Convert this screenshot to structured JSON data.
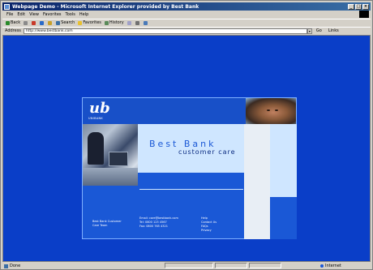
{
  "window": {
    "title": "Webpage Demo - Microsoft Internet Explorer provided by Best Bank",
    "minimize": "_",
    "maximize": "□",
    "close": "×"
  },
  "menu": {
    "items": [
      "File",
      "Edit",
      "View",
      "Favorites",
      "Tools",
      "Help"
    ]
  },
  "toolbar": {
    "back": "Back",
    "search": "Search",
    "favorites": "Favorites",
    "history": "History"
  },
  "address": {
    "label": "Address",
    "value": "http://www.bestbank.com",
    "go": "Go",
    "links": "Links"
  },
  "page": {
    "logo": "ub",
    "logo_sub": "UNIBANK",
    "headline": "Best Bank",
    "subline": "customer care",
    "footer": {
      "col1": [
        "Best Bank Customer",
        "Care Team"
      ],
      "col2": [
        "Email: care@bestbank.com",
        "Tel: 0800 123 4567",
        "Fax: 0800 765 4321"
      ],
      "col3": [
        "Help",
        "Contact Us",
        "FAQs",
        "Privacy"
      ]
    }
  },
  "status": {
    "text": "Done",
    "zone": "Internet"
  }
}
